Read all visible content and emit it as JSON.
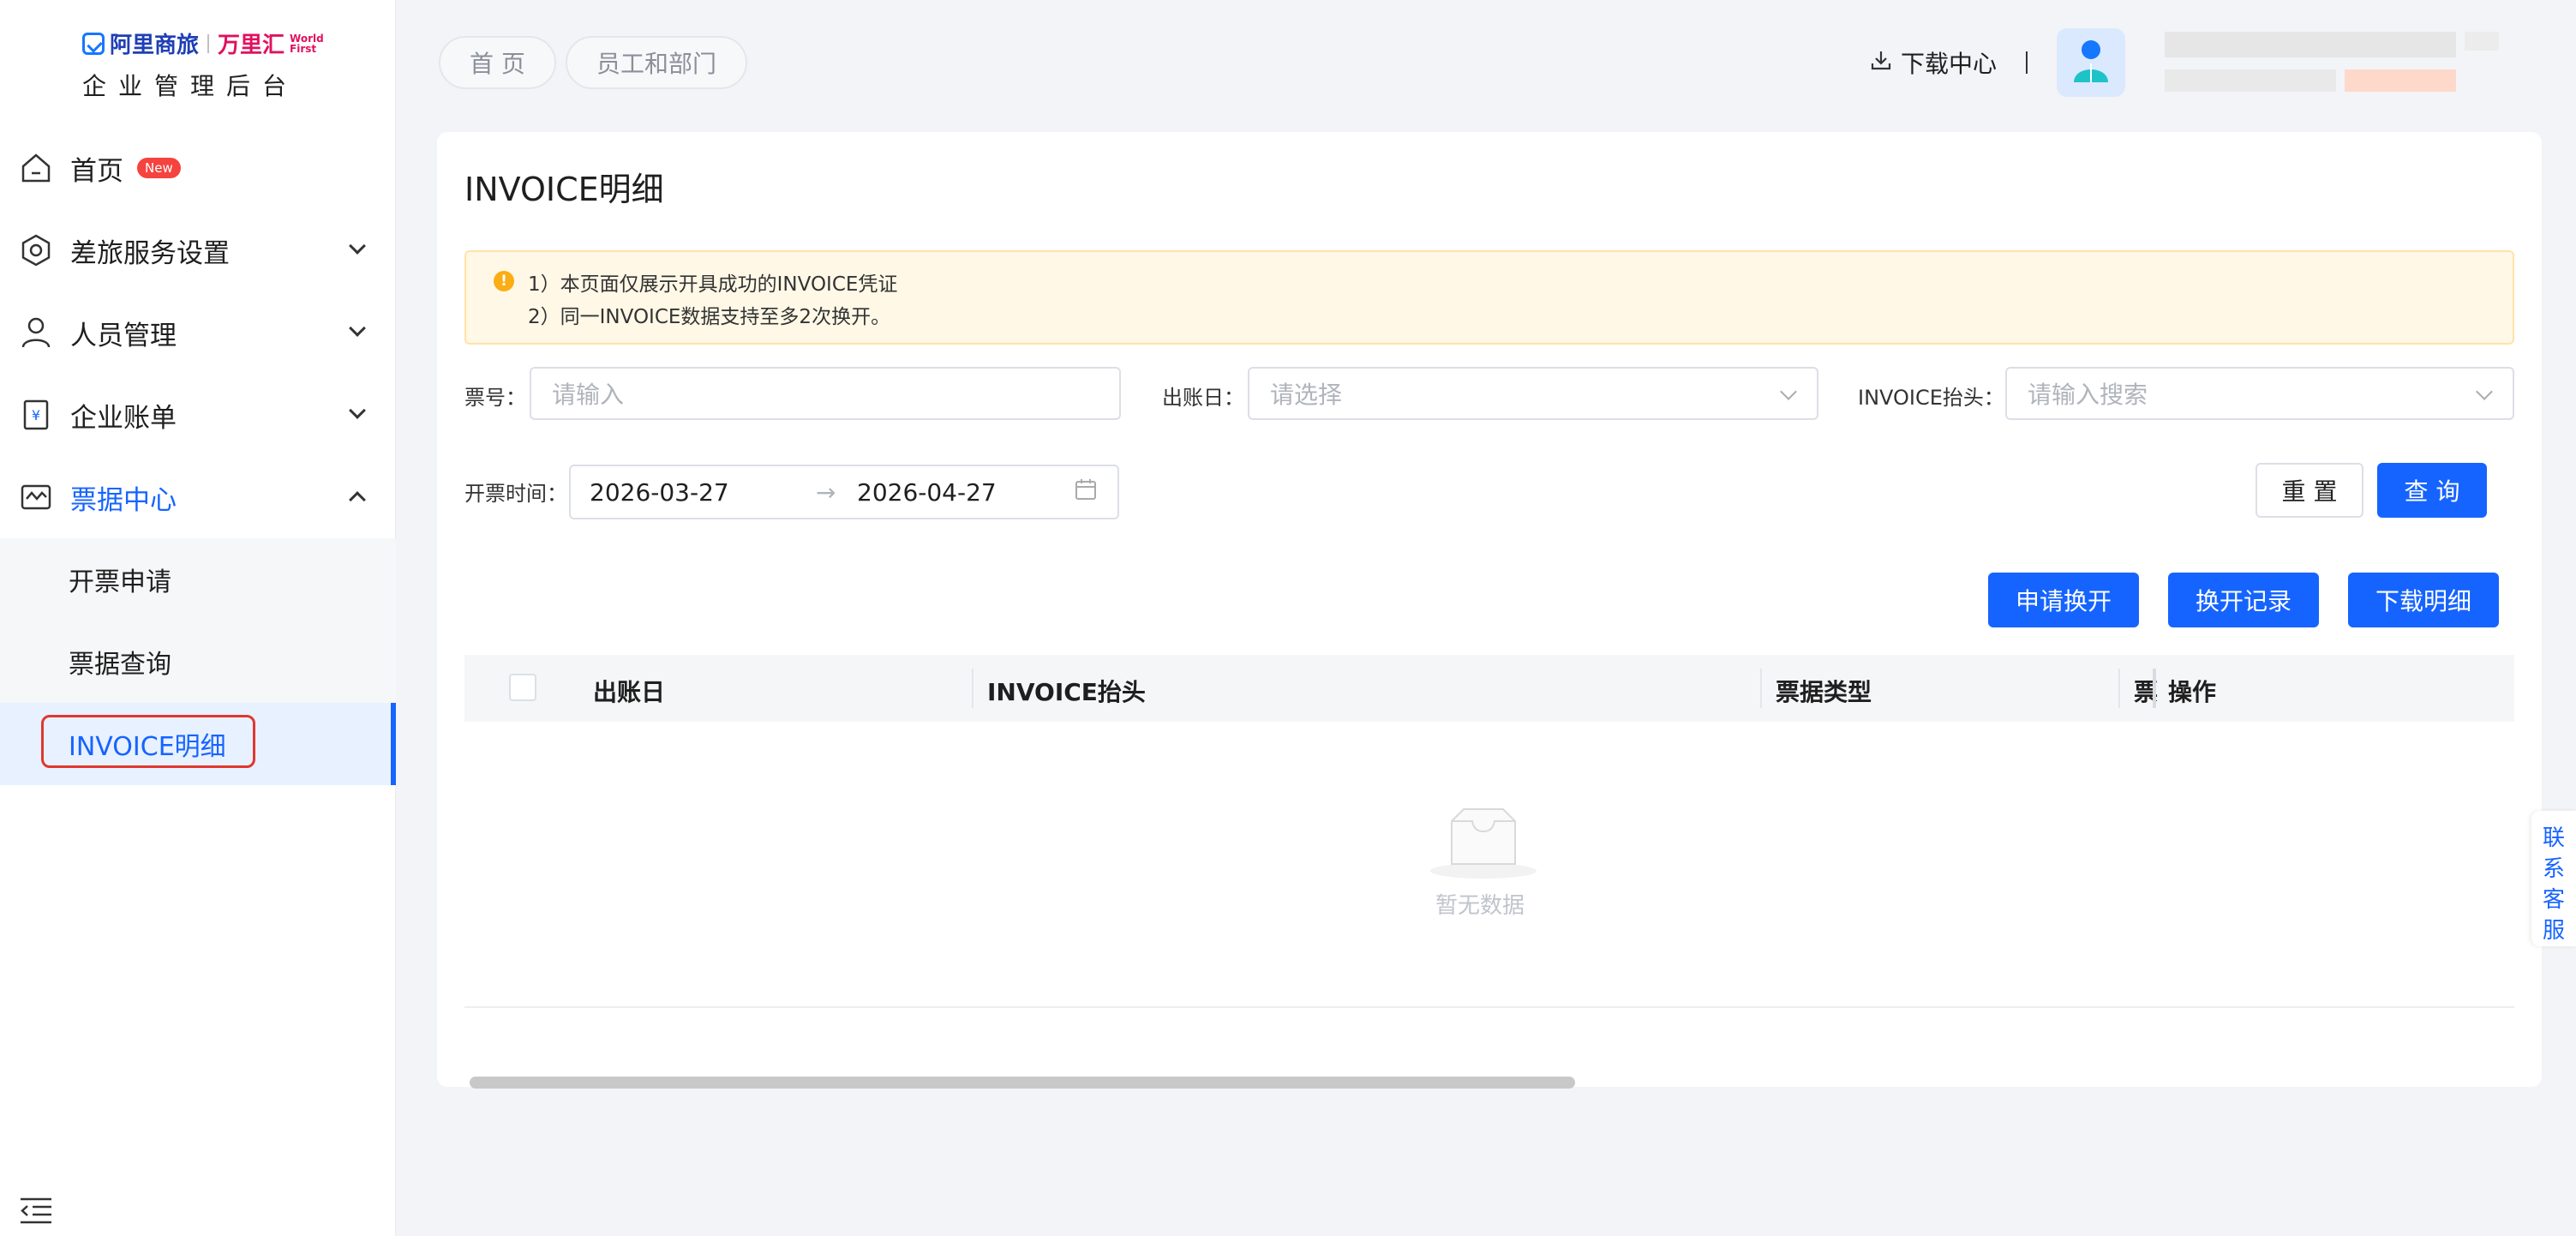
{
  "sidebar": {
    "logo": {
      "brand_a": "阿里商旅",
      "brand_b": "万里汇",
      "brand_wf_1": "World",
      "brand_wf_2": "First",
      "subtitle": "企业管理后台"
    },
    "items": [
      {
        "label": "首页",
        "badge": "New",
        "icon": "home-icon"
      },
      {
        "label": "差旅服务设置",
        "icon": "settings-icon"
      },
      {
        "label": "人员管理",
        "icon": "user-icon"
      },
      {
        "label": "企业账单",
        "icon": "bill-icon"
      },
      {
        "label": "票据中心",
        "icon": "invoice-icon",
        "active": true
      }
    ],
    "subitems": [
      {
        "label": "开票申请"
      },
      {
        "label": "票据查询"
      },
      {
        "label": "INVOICE明细",
        "selected": true
      }
    ]
  },
  "header": {
    "breadcrumbs": [
      "首 页",
      "员工和部门"
    ],
    "download_center": "下载中心",
    "divider": "|"
  },
  "main": {
    "title": "INVOICE明细",
    "notice": [
      "1）本页面仅展示开具成功的INVOICE凭证",
      "2）同一INVOICE数据支持至多2次换开。"
    ],
    "filters": {
      "ticket_no_label": "票号：",
      "ticket_no_placeholder": "请输入",
      "bill_date_label": "出账日：",
      "bill_date_placeholder": "请选择",
      "invoice_title_label": "INVOICE抬头：",
      "invoice_title_placeholder": "请输入搜索",
      "issue_time_label": "开票时间：",
      "date_start": "2026-03-27",
      "date_sep": "→",
      "date_end": "2026-04-27"
    },
    "buttons": {
      "reset": "重 置",
      "query": "查 询",
      "apply_reissue": "申请换开",
      "reissue_records": "换开记录",
      "download_detail": "下载明细"
    },
    "table": {
      "columns": [
        "出账日",
        "INVOICE抬头",
        "票据类型",
        "票",
        "操作"
      ],
      "empty_text": "暂无数据"
    }
  },
  "float_help": {
    "label": "联系客服"
  },
  "colors": {
    "primary": "#1664ff",
    "badge": "#f5433f",
    "notice_bg": "#fff8e6",
    "highlight": "#e0372f"
  }
}
